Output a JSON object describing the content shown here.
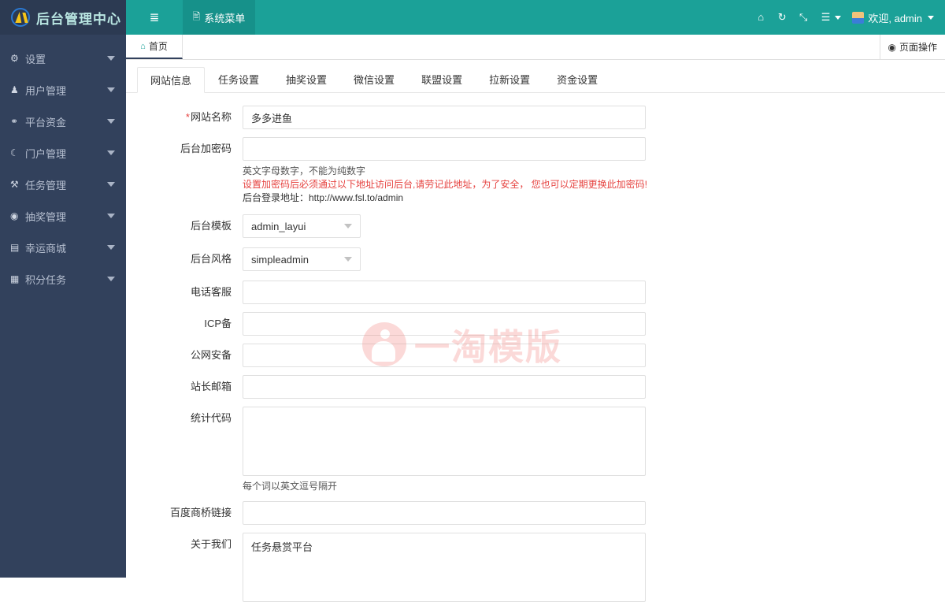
{
  "brand": {
    "logo_icon": "circle-logo-icon",
    "title": "后台管理中心"
  },
  "topbar": {
    "hamburger_icon": "list-icon",
    "system_menu": {
      "icon": "id-card-icon",
      "label": "系统菜单"
    },
    "icons": [
      {
        "name": "home-icon",
        "glyph": "⌂"
      },
      {
        "name": "refresh-icon",
        "glyph": "↻"
      },
      {
        "name": "fullscreen-icon",
        "glyph": "⤡"
      }
    ],
    "bars_menu": {
      "icon": "bars-icon",
      "glyph": "☰"
    },
    "user": {
      "avatar_icon": "avatar-icon",
      "label": "欢迎, admin"
    }
  },
  "sidebar": {
    "items": [
      {
        "label": "设置",
        "icon": "gears-icon",
        "glyph": "⚙"
      },
      {
        "label": "用户管理",
        "icon": "users-icon",
        "glyph": "♟"
      },
      {
        "label": "平台资金",
        "icon": "bank-icon",
        "glyph": "⛭"
      },
      {
        "label": "门户管理",
        "icon": "moon-icon",
        "glyph": "☾"
      },
      {
        "label": "任务管理",
        "icon": "task-icon",
        "glyph": "⚒"
      },
      {
        "label": "抽奖管理",
        "icon": "bullseye-icon",
        "glyph": "◉"
      },
      {
        "label": "幸运商城",
        "icon": "cart-icon",
        "glyph": "▤"
      },
      {
        "label": "积分任务",
        "icon": "grid-icon",
        "glyph": "▓"
      }
    ],
    "arrow_icon": "chevron-down-icon"
  },
  "pagetabs": {
    "tabs": [
      {
        "label": "首页",
        "icon": "home-icon",
        "glyph": "⌂",
        "active": true
      }
    ],
    "page_action": {
      "label": "页面操作",
      "icon": "dot-circle-icon",
      "glyph": "◉"
    }
  },
  "form_tabs": [
    {
      "label": "网站信息",
      "active": true
    },
    {
      "label": "任务设置",
      "active": false
    },
    {
      "label": "抽奖设置",
      "active": false
    },
    {
      "label": "微信设置",
      "active": false
    },
    {
      "label": "联盟设置",
      "active": false
    },
    {
      "label": "拉新设置",
      "active": false
    },
    {
      "label": "资金设置",
      "active": false
    }
  ],
  "form": {
    "site_name": {
      "label": "网站名称",
      "required_mark": "*",
      "value": "多多进鱼",
      "placeholder": ""
    },
    "admin_password": {
      "label": "后台加密码",
      "value": "",
      "placeholder": "",
      "hint1": "英文字母数字，不能为纯数字",
      "hint_red": "设置加密码后必须通过以下地址访问后台,请劳记此地址，为了安全， 您也可以定期更换此加密码!",
      "hint2": "后台登录地址：http://www.fsl.to/admin"
    },
    "admin_template": {
      "label": "后台模板",
      "value": "admin_layui"
    },
    "admin_style": {
      "label": "后台风格",
      "value": "simpleadmin"
    },
    "phone_service": {
      "label": "电话客服",
      "value": "",
      "placeholder": ""
    },
    "icp": {
      "label": "ICP备",
      "value": "",
      "placeholder": ""
    },
    "gongwang": {
      "label": "公网安备",
      "value": "",
      "placeholder": ""
    },
    "webmaster_mail": {
      "label": "站长邮箱",
      "value": "",
      "placeholder": ""
    },
    "stats_code": {
      "label": "统计代码",
      "value": "",
      "placeholder": "",
      "hint": "每个词以英文逗号隔开"
    },
    "baidu_bridge": {
      "label": "百度商桥链接",
      "value": "",
      "placeholder": ""
    },
    "about_us": {
      "label": "关于我们",
      "value": "任务悬赏平台",
      "placeholder": ""
    }
  },
  "watermark": {
    "text": "一淘模版",
    "logo_icon": "watermark-logo-icon"
  },
  "colors": {
    "teal": "#1ba198",
    "teal_dark": "#16918a",
    "sidebar": "#32415c",
    "logo_bg": "#2c3a52",
    "accent_red": "#e64340",
    "watermark": "#f3857f"
  }
}
